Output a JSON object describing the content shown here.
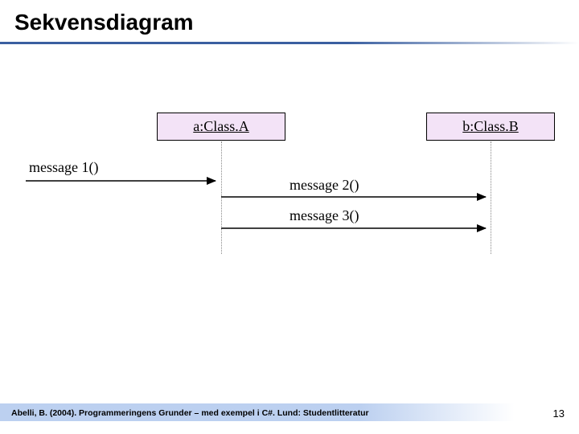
{
  "title": "Sekvensdiagram",
  "objects": {
    "a": "a:Class.A",
    "b": "b:Class.B"
  },
  "messages": {
    "m1": "message 1()",
    "m2": "message 2()",
    "m3": "message 3()"
  },
  "footer": "Abelli, B. (2004). Programmeringens Grunder – med exempel i C#. Lund: Studentlitteratur",
  "page": "13"
}
